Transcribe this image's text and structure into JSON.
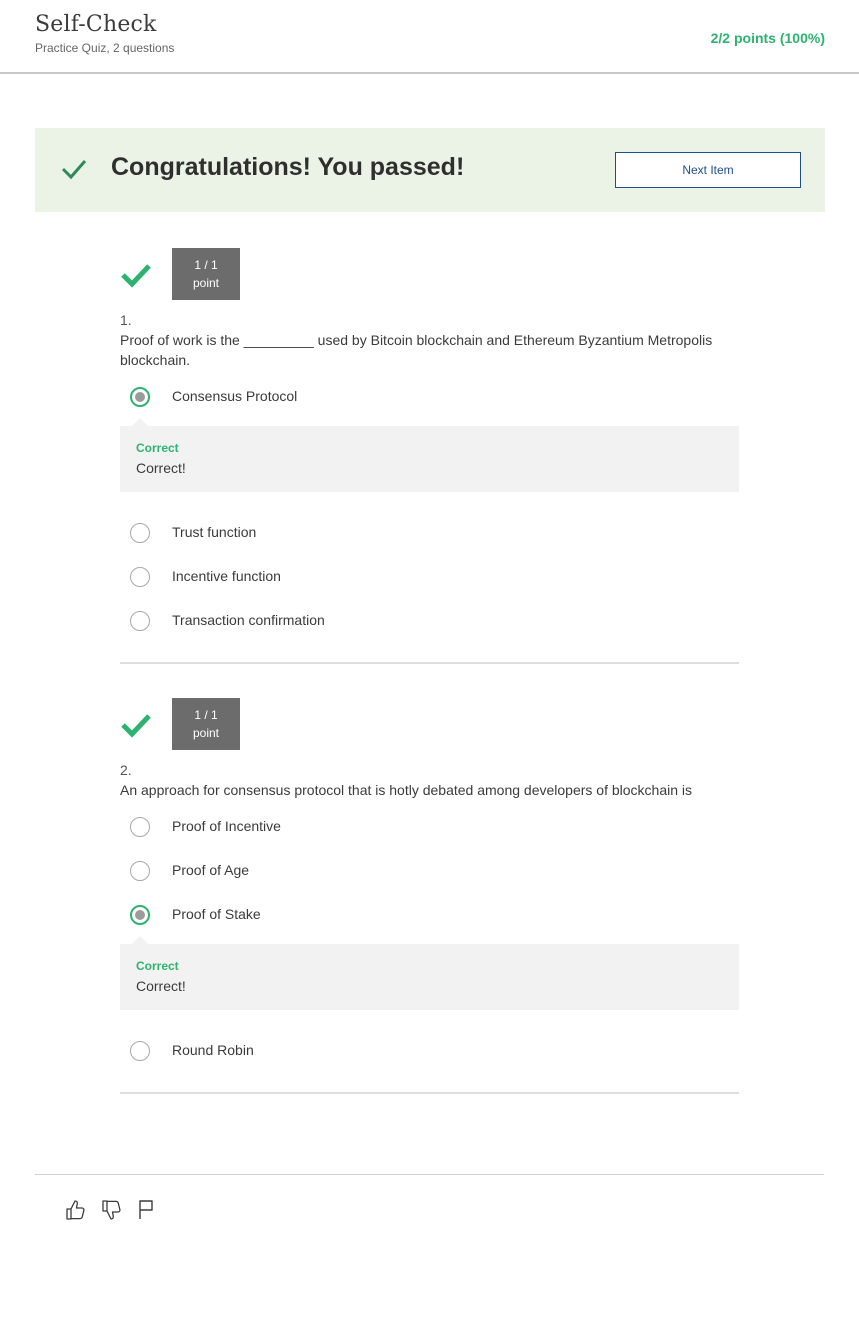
{
  "header": {
    "title": "Self-Check",
    "subtitle": "Practice Quiz, 2 questions",
    "score": "2/2 points (100%)"
  },
  "banner": {
    "message": "Congratulations! You passed!",
    "next_button": "Next Item"
  },
  "questions": [
    {
      "points_value": "1 / 1",
      "points_unit": "point",
      "number": "1.",
      "text": "Proof of work is the _________ used by Bitcoin blockchain and Ethereum Byzantium Metropolis blockchain.",
      "options": [
        {
          "label": "Consensus Protocol",
          "selected": true
        },
        {
          "label": "Trust function",
          "selected": false
        },
        {
          "label": "Incentive function",
          "selected": false
        },
        {
          "label": "Transaction confirmation",
          "selected": false
        }
      ],
      "feedback": {
        "title": "Correct",
        "text": "Correct!"
      }
    },
    {
      "points_value": "1 / 1",
      "points_unit": "point",
      "number": "2.",
      "text": "An approach for consensus protocol that is hotly debated among developers of blockchain is",
      "options": [
        {
          "label": "Proof of Incentive",
          "selected": false
        },
        {
          "label": "Proof of Age",
          "selected": false
        },
        {
          "label": "Proof of Stake",
          "selected": true
        },
        {
          "label": "Round Robin",
          "selected": false
        }
      ],
      "feedback": {
        "title": "Correct",
        "text": "Correct!"
      }
    }
  ],
  "actions": {
    "icons": [
      "thumbs-up-icon",
      "thumbs-down-icon",
      "flag-icon"
    ]
  },
  "colors": {
    "accent_green": "#2db36f",
    "banner_bg": "#eaf3e6",
    "button_blue": "#1f4e8c"
  }
}
